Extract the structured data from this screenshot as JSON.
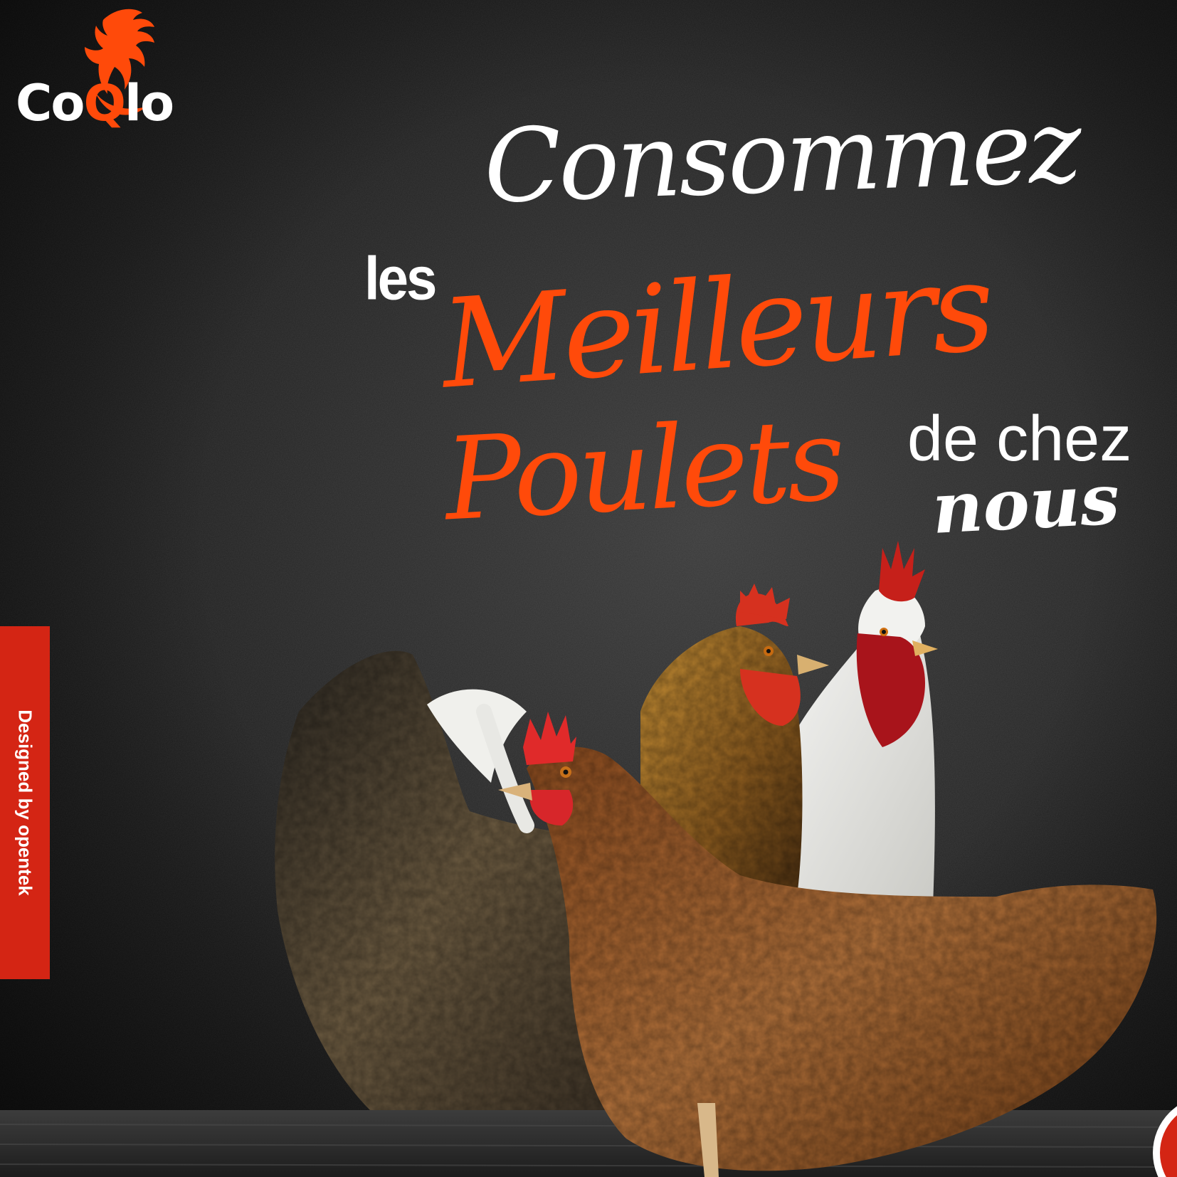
{
  "brand": {
    "name": "CoQlo",
    "logo_icon": "rooster-head-icon",
    "colors": {
      "accent": "#ff4a0a",
      "text": "#ffffff",
      "background": "#1b1b1b",
      "tab": "#d42514"
    }
  },
  "headline": {
    "line1": "Consommez",
    "line2_prefix": "les",
    "line2_main": "Meilleurs",
    "line3_main": "Poulets",
    "line3_suffix_top": "de chez",
    "line3_suffix_bottom": "nous"
  },
  "side_tab": {
    "label": "Designed by opentek"
  },
  "illustration": {
    "subject": "chickens-group-image"
  }
}
